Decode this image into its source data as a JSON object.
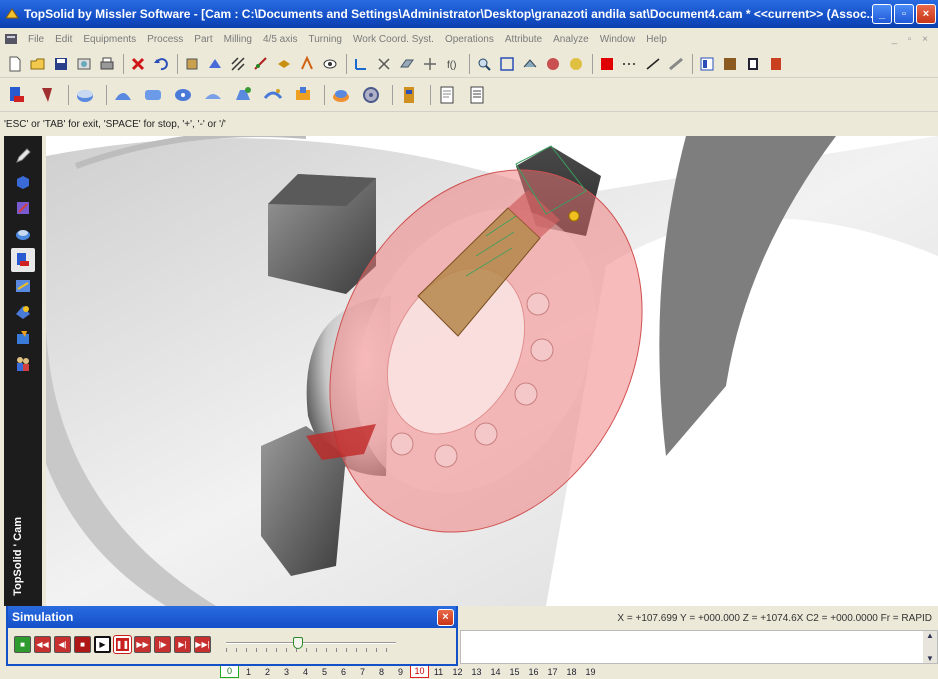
{
  "window": {
    "title": "TopSolid by Missler Software - [Cam : C:\\Documents and Settings\\Administrator\\Desktop\\granazoti andila sat\\Document4.cam *  <<current>> (Assoc...",
    "minimize_label": "_",
    "maximize_label": "▫",
    "close_label": "×"
  },
  "menu": {
    "items": [
      "File",
      "Edit",
      "Equipments",
      "Process",
      "Part",
      "Milling",
      "4/5 axis",
      "Turning",
      "Work Coord. Syst.",
      "Operations",
      "Attribute",
      "Analyze",
      "Window",
      "Help"
    ],
    "mdi_controls": "_ ▫ ×"
  },
  "prompt": "'ESC' or 'TAB' for exit, 'SPACE' for stop, '+', '-' or '/'",
  "sidebar": {
    "brand": "TopSolid ' Cam"
  },
  "status": {
    "coords": "X = +107.699  Y = +000.000  Z = +1074.6X  C2 = +000.0000  Fr = RAPID"
  },
  "layers": {
    "items": [
      "0",
      "1",
      "2",
      "3",
      "4",
      "5",
      "6",
      "7",
      "8",
      "9",
      "10",
      "11",
      "12",
      "13",
      "14",
      "15",
      "16",
      "17",
      "18",
      "19"
    ],
    "active_green": "0",
    "active_red": "10"
  },
  "simulation": {
    "title": "Simulation",
    "close_label": "×",
    "progress": 0.42,
    "colors": {
      "accent": "#1450c8",
      "start": "#2e9b2e",
      "stop": "#c81e1e"
    }
  }
}
